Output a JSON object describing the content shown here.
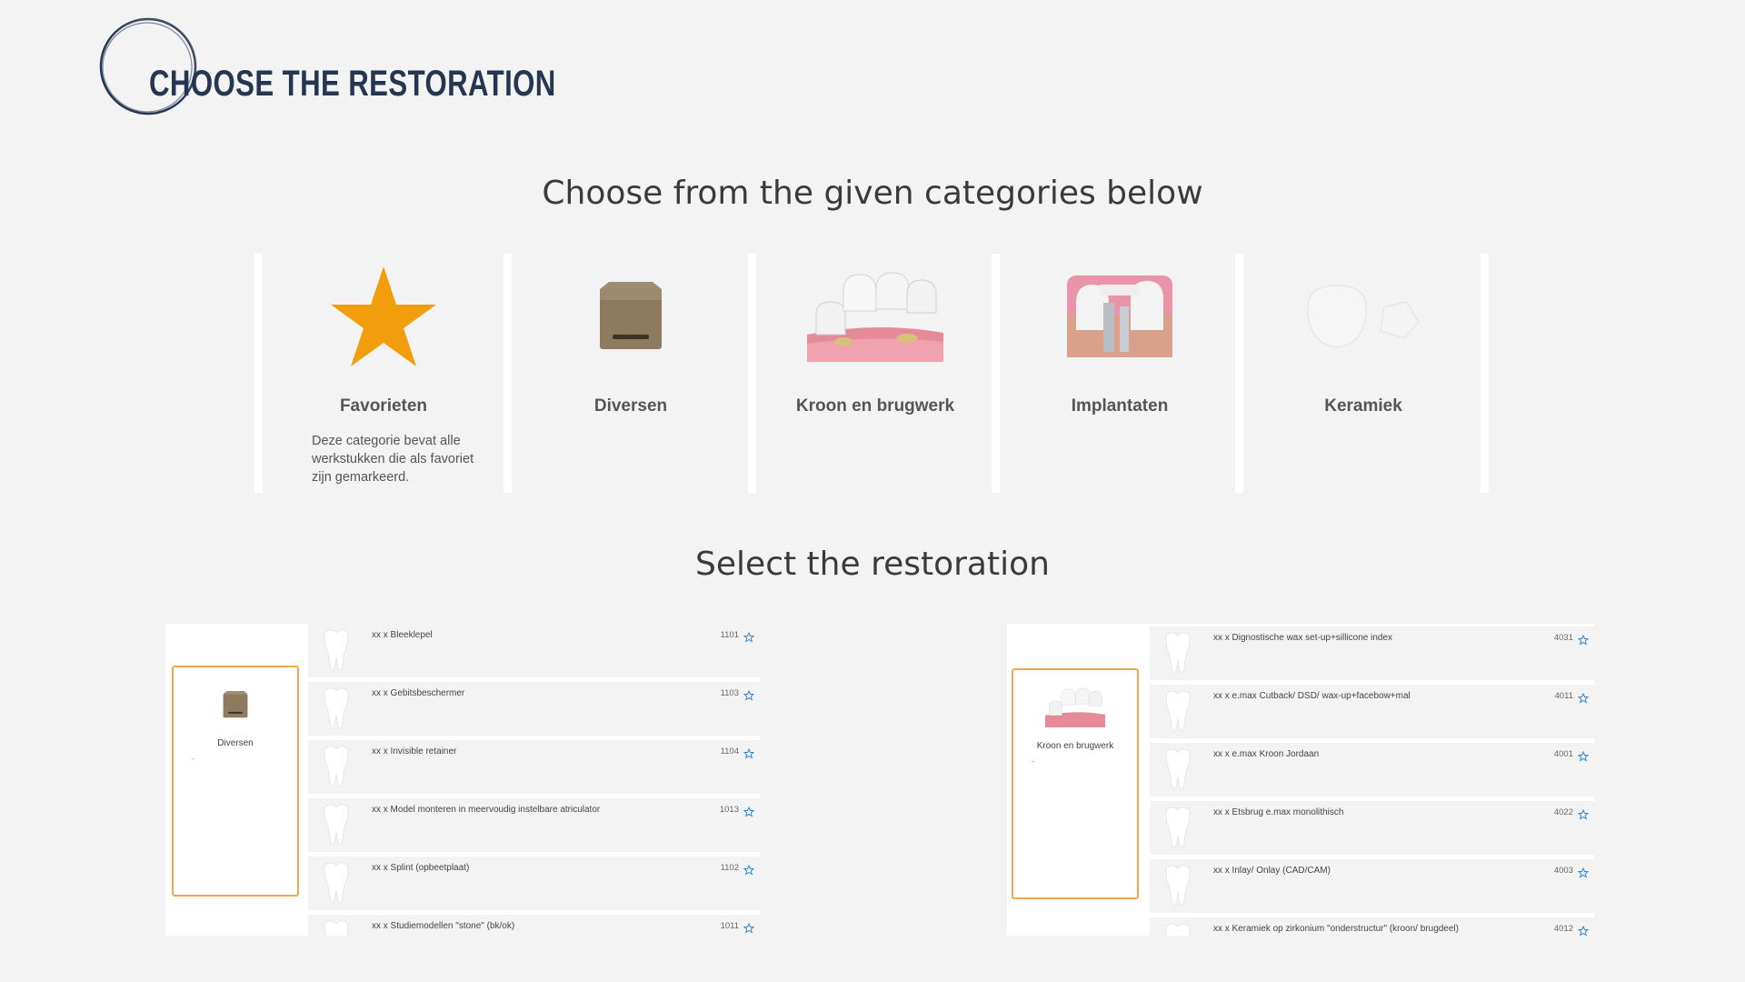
{
  "header": {
    "title": "CHOOSE THE RESTORATION"
  },
  "headings": {
    "categories": "Choose from the given categories below",
    "restoration": "Select the restoration"
  },
  "categories": [
    {
      "label": "Favorieten",
      "icon": "star-icon",
      "description": "Deze categorie bevat alle werkstukken die als favoriet zijn gemarkeerd."
    },
    {
      "label": "Diversen",
      "icon": "box-icon"
    },
    {
      "label": "Kroon en brugwerk",
      "icon": "bridge-icon"
    },
    {
      "label": "Implantaten",
      "icon": "implant-icon"
    },
    {
      "label": "Keramiek",
      "icon": "ceramic-icon"
    }
  ],
  "left_panel": {
    "selected": {
      "label": "Diversen",
      "note": "-",
      "icon": "box-icon"
    },
    "items": [
      {
        "name": "xx x Bleeklepel",
        "code": "1101"
      },
      {
        "name": "xx x Gebitsbeschermer",
        "code": "1103"
      },
      {
        "name": "xx x Invisible retainer",
        "code": "1104"
      },
      {
        "name": "xx x Model monteren in meervoudig instelbare atriculator",
        "code": "1013"
      },
      {
        "name": "xx x Splint (opbeetplaat)",
        "code": "1102"
      },
      {
        "name": "xx x Studiemodellen \"stone\" (bk/ok)",
        "code": "1011"
      }
    ]
  },
  "right_panel": {
    "selected": {
      "label": "Kroon en brugwerk",
      "note": "-",
      "icon": "bridge-icon"
    },
    "items": [
      {
        "name": "xx x Dignostische wax set-up+sillicone index",
        "code": "4031"
      },
      {
        "name": "xx x e.max Cutback/ DSD/ wax-up+facebow+mal",
        "code": "4011"
      },
      {
        "name": "xx x e.max Kroon Jordaan",
        "code": "4001"
      },
      {
        "name": "xx x Etsbrug e.max monolithisch",
        "code": "4022"
      },
      {
        "name": "xx x Inlay/ Onlay (CAD/CAM)",
        "code": "4003"
      },
      {
        "name": "xx x Keramiek op zirkonium \"onderstructur\" (kroon/ brugdeel)",
        "code": "4012"
      }
    ]
  },
  "colors": {
    "title": "#263550",
    "accent_star": "#f29e0c",
    "selection_border": "#f0a94a",
    "favorite_star": "#3a86d6"
  }
}
